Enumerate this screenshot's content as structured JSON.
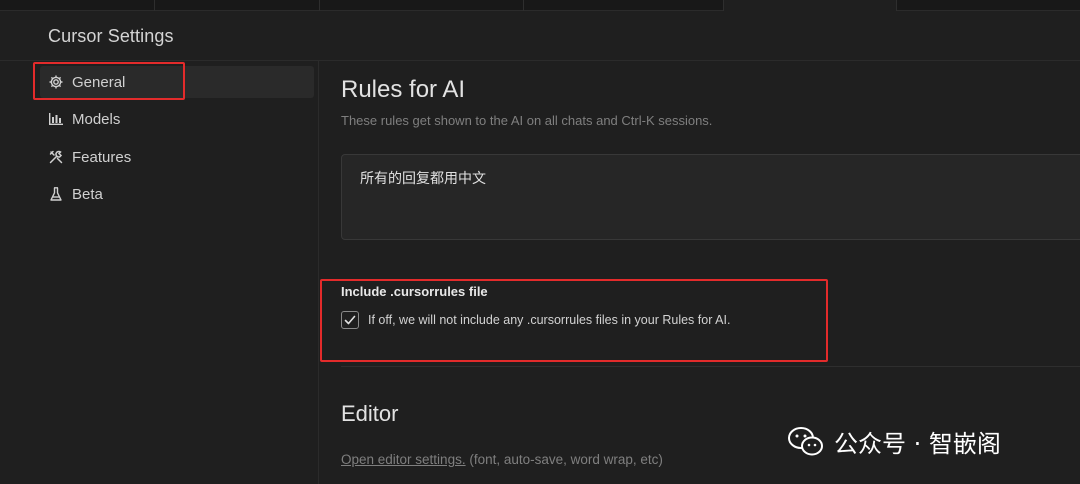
{
  "window": {
    "title": "Cursor Settings"
  },
  "sidebar": {
    "items": [
      {
        "label": "General",
        "icon": "gear-icon",
        "active": true
      },
      {
        "label": "Models",
        "icon": "bar-chart-icon",
        "active": false
      },
      {
        "label": "Features",
        "icon": "tools-icon",
        "active": false
      },
      {
        "label": "Beta",
        "icon": "flask-icon",
        "active": false
      }
    ]
  },
  "rules": {
    "title": "Rules for AI",
    "description": "These rules get shown to the AI on all chats and Ctrl-K sessions.",
    "value": "所有的回复都用中文"
  },
  "cursorrules": {
    "title": "Include .cursorrules file",
    "checkbox_label": "If off, we will not include any .cursorrules files in your Rules for AI.",
    "checked": true
  },
  "editor": {
    "title": "Editor",
    "link_label": "Open editor settings.",
    "link_suffix": " (font, auto-save, word wrap, etc)"
  },
  "watermark": {
    "text": "公众号 · 智嵌阁",
    "icon": "wechat-icon"
  },
  "colors": {
    "highlight": "#e32b2b",
    "background": "#1f1f1f",
    "active_item": "#2a2a2a"
  }
}
